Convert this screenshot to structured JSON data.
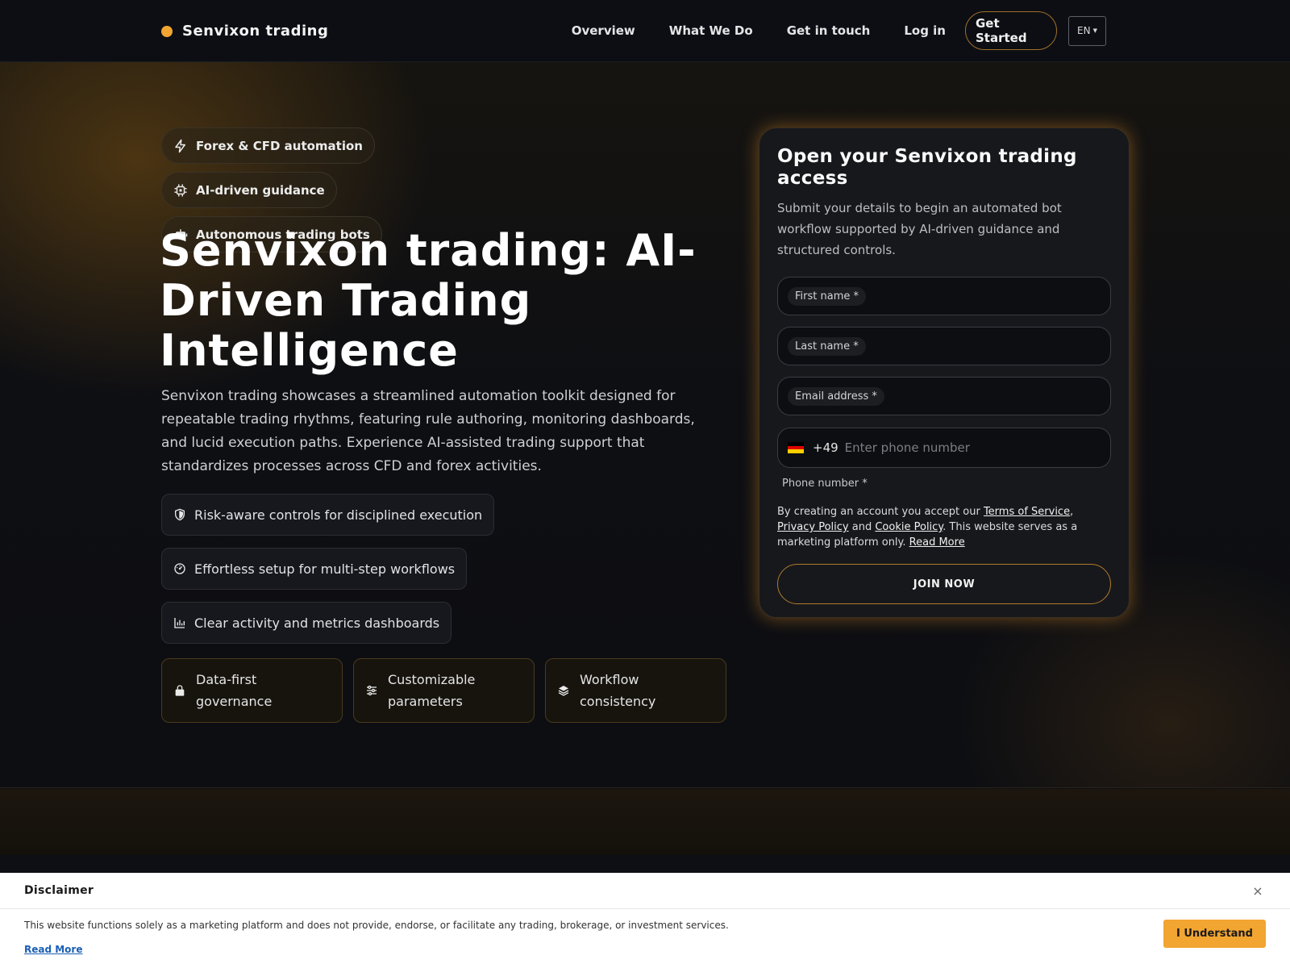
{
  "colors": {
    "accent": "#f2a531",
    "background": "#0d0f14",
    "panel": "#17181c",
    "disclaimer_bg": "#ffffff",
    "link_blue": "#1a5fb4"
  },
  "header": {
    "brand": "Senvixon trading",
    "nav": [
      "Overview",
      "What We Do",
      "Get in touch",
      "Log in"
    ],
    "get_started": "Get Started",
    "language": "EN"
  },
  "hero": {
    "tags": [
      {
        "label": "Forex & CFD automation",
        "icon": "lightning-icon"
      },
      {
        "label": "AI-driven guidance",
        "icon": "chip-icon"
      },
      {
        "label": "Autonomous trading bots",
        "icon": "robot-icon"
      }
    ],
    "title": "Senvixon trading: AI-Driven Trading Intelligence",
    "description": "Senvixon trading showcases a streamlined automation toolkit designed for repeatable trading rhythms, featuring rule authoring, monitoring dashboards, and lucid execution paths. Experience AI-assisted trading support that standardizes processes across CFD and forex activities.",
    "features": [
      {
        "label": "Risk-aware controls for disciplined execution",
        "icon": "shield-icon"
      },
      {
        "label": "Effortless setup for multi-step workflows",
        "icon": "gauge-icon"
      },
      {
        "label": "Clear activity and metrics dashboards",
        "icon": "bar-chart-icon"
      }
    ],
    "cards": [
      {
        "label": "Data-first governance",
        "icon": "lock-icon"
      },
      {
        "label": "Customizable parameters",
        "icon": "sliders-icon"
      },
      {
        "label": "Workflow consistency",
        "icon": "layers-icon"
      }
    ]
  },
  "form": {
    "title": "Open your Senvixon trading access",
    "subtitle": "Submit your details to begin an automated bot workflow supported by AI-driven guidance and structured controls.",
    "first_name": "First name *",
    "last_name": "Last name *",
    "email": "Email address *",
    "country_code": "+49",
    "phone_placeholder": "Enter phone number",
    "phone_label": "Phone number *",
    "legal_prefix": "By creating an account you accept our",
    "terms": "Terms of Service",
    "privacy": "Privacy Policy",
    "and": "and",
    "cookie": "Cookie Policy",
    "legal_suffix": ". This website serves as a marketing platform only.",
    "read_more": "Read More",
    "submit": "JOIN NOW"
  },
  "disclaimer": {
    "title": "Disclaimer",
    "close": "×",
    "text": "This website functions solely as a marketing platform and does not provide, endorse, or facilitate any trading, brokerage, or investment services.",
    "read_more": "Read More",
    "button": "I Understand"
  }
}
